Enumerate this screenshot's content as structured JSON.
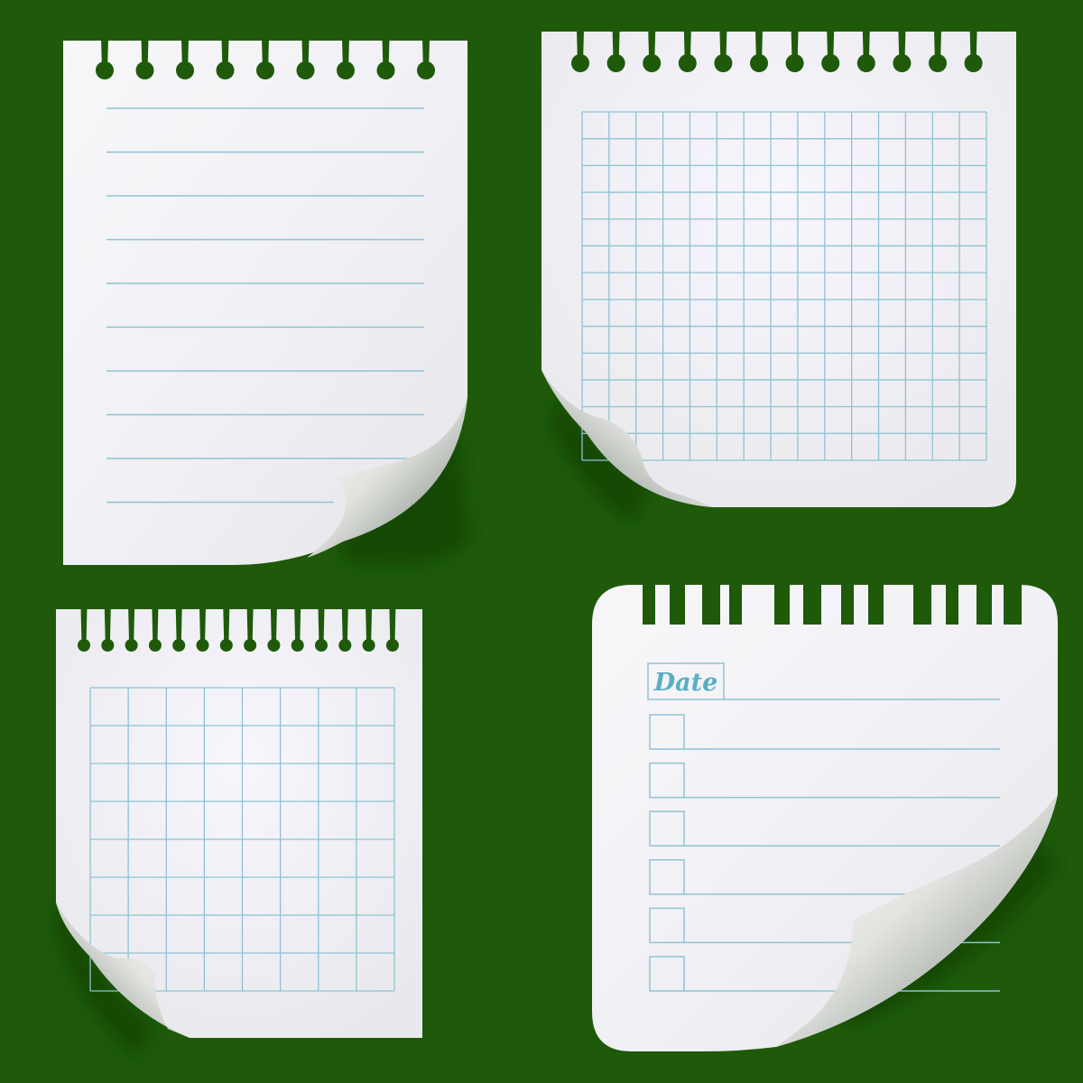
{
  "scene": {
    "background_color": "#1e5a0a",
    "paper_color": "#f2f2f4",
    "rule_color": "#8ec3d4",
    "date_color": "#5aaec4"
  },
  "notes": [
    {
      "name": "lined-note",
      "style": "lined",
      "lines": 10,
      "curled_corner": "bottom-right"
    },
    {
      "name": "large-grid-note",
      "style": "grid",
      "columns": 15,
      "rows": 13,
      "curled_corner": "bottom-left"
    },
    {
      "name": "small-grid-note",
      "style": "grid",
      "columns": 8,
      "rows": 8,
      "curled_corner": "bottom-left"
    },
    {
      "name": "checklist-note",
      "style": "checklist",
      "date_label": "Date",
      "checkboxes": 6,
      "curled_corner": "bottom-right"
    }
  ]
}
